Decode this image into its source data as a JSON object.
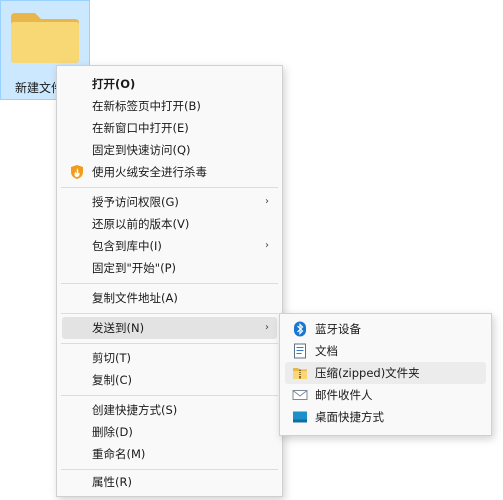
{
  "desktop": {
    "folder_label": "新建文件夹"
  },
  "context_menu": {
    "items": [
      {
        "label": "打开(O)"
      },
      {
        "label": "在新标签页中打开(B)"
      },
      {
        "label": "在新窗口中打开(E)"
      },
      {
        "label": "固定到快速访问(Q)"
      },
      {
        "label": "使用火绒安全进行杀毒",
        "icon": "huorong-shield-icon"
      },
      {
        "label": "授予访问权限(G)",
        "submenu_arrow": "›"
      },
      {
        "label": "还原以前的版本(V)"
      },
      {
        "label": "包含到库中(I)",
        "submenu_arrow": "›"
      },
      {
        "label": "固定到\"开始\"(P)"
      },
      {
        "label": "复制文件地址(A)"
      },
      {
        "label": "发送到(N)",
        "submenu_arrow": "›"
      },
      {
        "label": "剪切(T)"
      },
      {
        "label": "复制(C)"
      },
      {
        "label": "创建快捷方式(S)"
      },
      {
        "label": "删除(D)"
      },
      {
        "label": "重命名(M)"
      },
      {
        "label": "属性(R)"
      }
    ]
  },
  "send_to_menu": {
    "items": [
      {
        "label": "蓝牙设备",
        "icon": "bluetooth-icon"
      },
      {
        "label": "文档",
        "icon": "document-icon"
      },
      {
        "label": "压缩(zipped)文件夹",
        "icon": "zip-folder-icon"
      },
      {
        "label": "邮件收件人",
        "icon": "mail-icon"
      },
      {
        "label": "桌面快捷方式",
        "icon": "desktop-icon"
      }
    ]
  },
  "colors": {
    "selection_bg": "#cce8ff",
    "menu_bg": "#f9f9f9",
    "hover_bg": "#e3e3e3",
    "folder_yellow": "#f8d775"
  }
}
